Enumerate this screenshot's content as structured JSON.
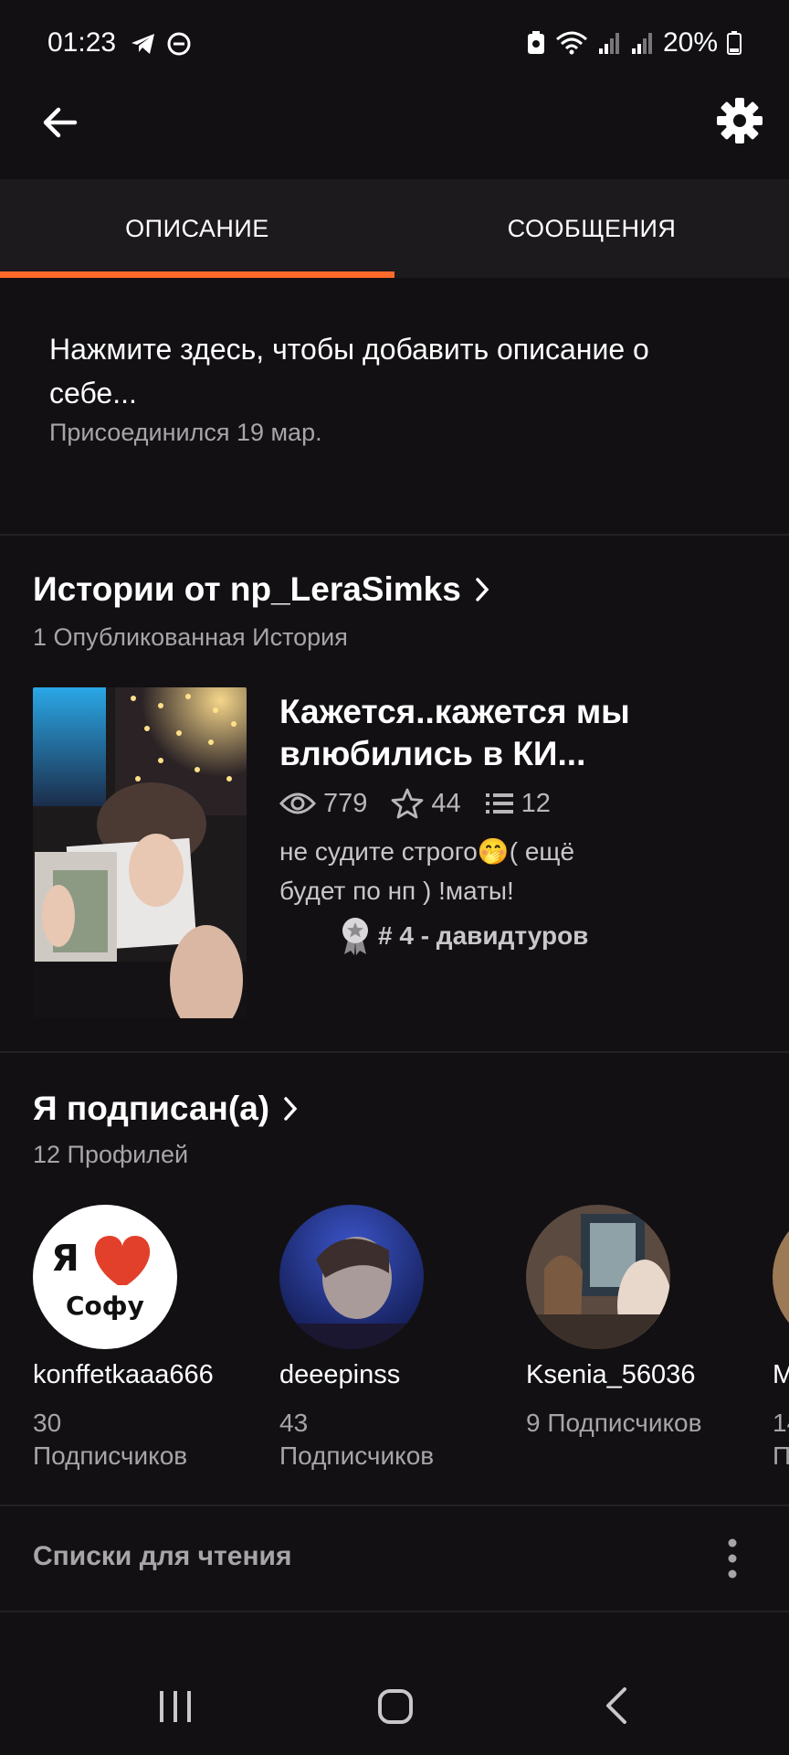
{
  "status_bar": {
    "time": "01:23",
    "battery": "20%"
  },
  "tabs": [
    {
      "label": "ОПИСАНИЕ",
      "active": true
    },
    {
      "label": "СООБЩЕНИЯ",
      "active": false
    }
  ],
  "about": {
    "prompt": "Нажмите здесь, чтобы добавить описание о себе...",
    "joined": "Присоединился 19 мар."
  },
  "stories": {
    "title": "Истории от np_LeraSimks",
    "count_label": "1 Опубликованная История",
    "items": [
      {
        "title": "Кажется..кажется мы влюбились в КИ...",
        "views": "779",
        "votes": "44",
        "parts": "12",
        "description": "не судите строго🤭( ещё будет по нп ) !маты!",
        "rank": "# 4 - давидтуров"
      }
    ]
  },
  "following": {
    "title": "Я подписан(а)",
    "count_label": "12 Профилей",
    "profiles": [
      {
        "username": "konffetkaaa666",
        "followers": "30 Подписчиков",
        "avatar_text_top": "Я",
        "avatar_text_bottom": "Софу"
      },
      {
        "username": "deeepinss",
        "followers": "43 Подписчиков"
      },
      {
        "username": "Ksenia_56036",
        "followers": "9 Подписчиков"
      },
      {
        "username": "M",
        "followers": "14 П"
      }
    ]
  },
  "reading_lists": {
    "title": "Списки для чтения"
  },
  "colors": {
    "accent": "#ff6a2b",
    "background": "#121013",
    "tab_bar": "#1c1a1d"
  }
}
